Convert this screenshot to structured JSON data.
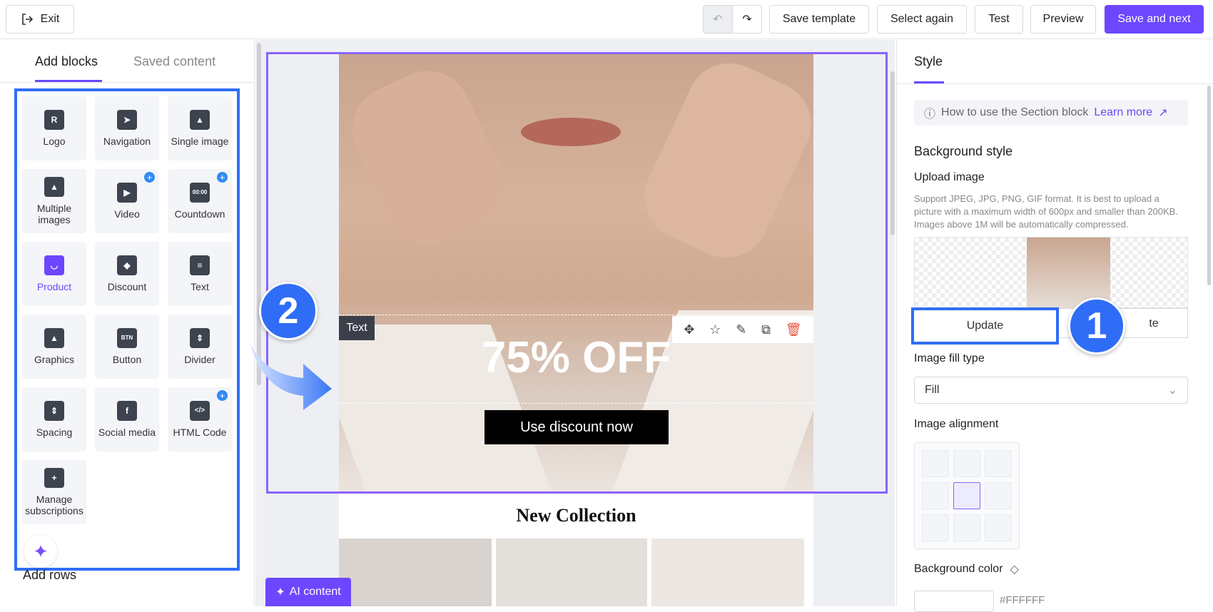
{
  "topbar": {
    "exit_label": "Exit",
    "save_template": "Save template",
    "select_again": "Select again",
    "test": "Test",
    "preview": "Preview",
    "save_next": "Save and next"
  },
  "left": {
    "tabs": [
      "Add blocks",
      "Saved content"
    ],
    "blocks": [
      {
        "label": "Logo",
        "icon": "logo-icon"
      },
      {
        "label": "Navigation",
        "icon": "navigation-icon"
      },
      {
        "label": "Single image",
        "icon": "image-icon"
      },
      {
        "label": "Multiple images",
        "icon": "images-icon"
      },
      {
        "label": "Video",
        "icon": "video-icon"
      },
      {
        "label": "Countdown",
        "icon": "countdown-icon"
      },
      {
        "label": "Product",
        "icon": "bag-icon"
      },
      {
        "label": "Discount",
        "icon": "tag-icon"
      },
      {
        "label": "Text",
        "icon": "text-icon"
      },
      {
        "label": "Graphics",
        "icon": "graphics-icon"
      },
      {
        "label": "Button",
        "icon": "button-icon"
      },
      {
        "label": "Divider",
        "icon": "divider-icon"
      },
      {
        "label": "Spacing",
        "icon": "spacing-icon"
      },
      {
        "label": "Social media",
        "icon": "facebook-icon"
      },
      {
        "label": "HTML Code",
        "icon": "code-icon"
      },
      {
        "label": "Manage subscriptions",
        "icon": "bookmark-plus-icon"
      }
    ],
    "add_rows": "Add rows"
  },
  "canvas": {
    "text_tag": "Text",
    "headline": "75% OFF",
    "cta": "Use discount now",
    "collection_title": "New Collection",
    "ai_content": "AI content",
    "step2": "2"
  },
  "right": {
    "tab": "Style",
    "help_text": "How to use the Section block",
    "learn_more": "Learn more",
    "background_style": "Background style",
    "upload_image": "Upload image",
    "support_text": "Support JPEG, JPG, PNG, GIF format. It is best to upload a picture with a maximum width of 600px and smaller than 200KB. Images above 1M will be automatically compressed.",
    "update_label": "Update",
    "delete_partial": "te",
    "step1": "1",
    "image_fill_type": "Image fill type",
    "fill_value": "Fill",
    "image_alignment": "Image alignment",
    "background_color": "Background color",
    "color_hex": "#FFFFFF"
  },
  "colors": {
    "accent": "#6c47ff",
    "highlight": "#2f6df6"
  }
}
